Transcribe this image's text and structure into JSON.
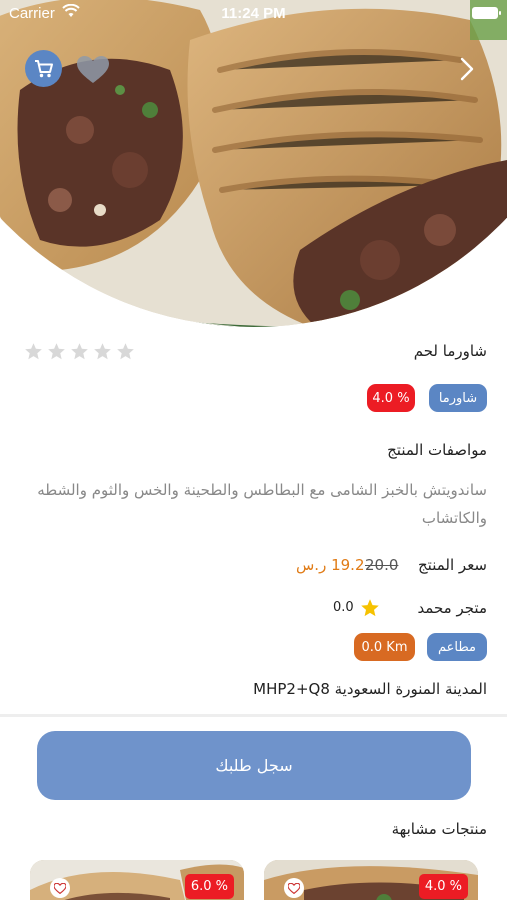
{
  "status_bar": {
    "carrier": "Carrier",
    "time": "11:24 PM"
  },
  "hero": {
    "image": "shawarma-wrap-photo",
    "cart_icon": "cart-icon",
    "favorite_icon": "heart-icon",
    "next_icon": "chevron-right-icon"
  },
  "product": {
    "name": "شاورما لحم",
    "rating": 0,
    "rating_max": 5,
    "category": "شاورما",
    "discount": "4.0 %",
    "specs_title": "مواصفات المنتج",
    "description": "ساندويتش بالخبز الشامى مع البطاطس والطحينة والخس والثوم والشطه والكاتشاب",
    "price_label": "سعر المنتج",
    "old_price": "20.0",
    "new_price": "19.2 ر.س"
  },
  "store": {
    "name": "متجر محمد",
    "rating": "0.0",
    "type": "مطاعم",
    "distance": "0.0 Km",
    "address": "المدينة المنورة السعودية MHP2+Q8"
  },
  "order_button": {
    "label": "سجل طلبك"
  },
  "similar": {
    "title": "منتجات مشابهة",
    "items": [
      {
        "discount": "6.0 %"
      },
      {
        "discount": "4.0 %"
      }
    ]
  },
  "colors": {
    "primary": "#5b86c4",
    "discount_red": "#ec1c24",
    "price_orange": "#e07b16",
    "distance_orange": "#d86a22"
  }
}
